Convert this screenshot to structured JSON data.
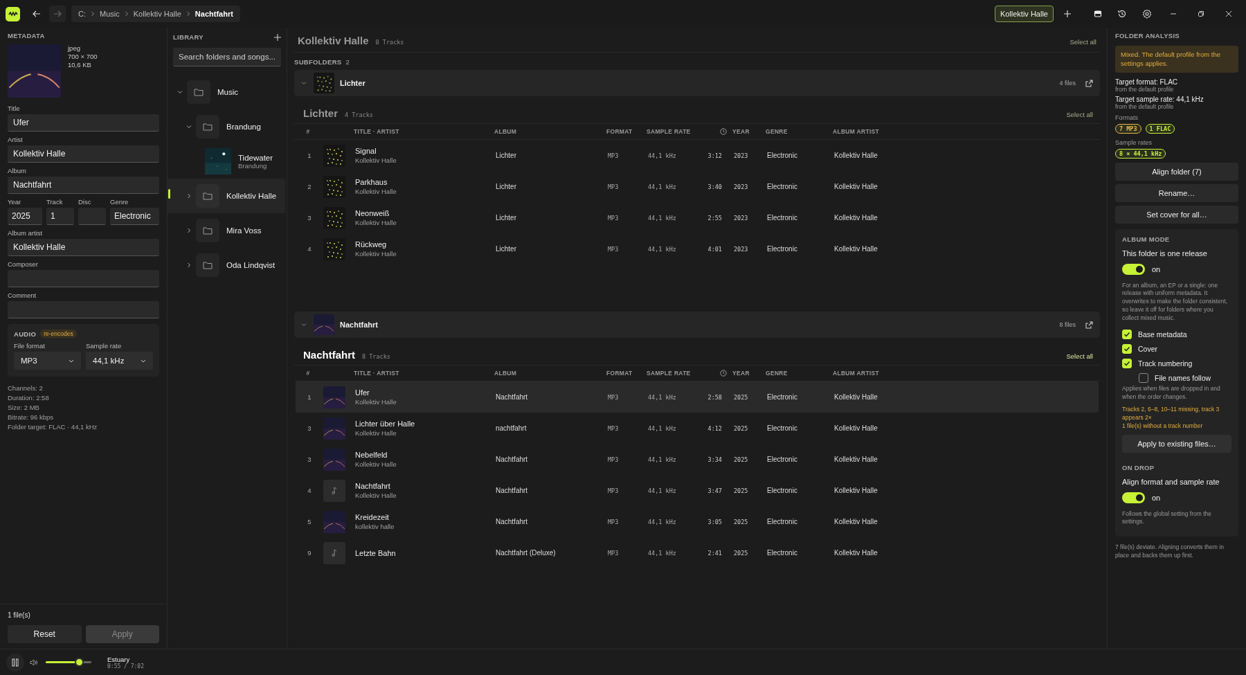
{
  "topbar": {
    "back_disabled": false,
    "forward_disabled": true,
    "breadcrumb": [
      "C:",
      "Music",
      "Kollektiv Halle",
      "Nachtfahrt"
    ],
    "context_chip": "Kollektiv Halle"
  },
  "metadata": {
    "heading": "METADATA",
    "cover": {
      "format": "jpeg",
      "dimensions": "700 × 700",
      "size": "10,6 KB"
    },
    "fields": [
      {
        "label": "Title",
        "value": "Ufer"
      },
      {
        "label": "Artist",
        "value": "Kollektiv Halle"
      },
      {
        "label": "Album",
        "value": "Nachtfahrt"
      }
    ],
    "row_fields": [
      {
        "label": "Year",
        "value": "2025"
      },
      {
        "label": "Track",
        "value": "1"
      },
      {
        "label": "Disc"
      },
      {
        "label": "Genre",
        "value": "Electronic"
      }
    ],
    "fields_after": [
      {
        "label": "Album artist",
        "value": "Kollektiv Halle"
      },
      {
        "label": "Composer"
      },
      {
        "label": "Comment"
      }
    ],
    "audio": {
      "heading": "AUDIO",
      "badge": "re-encodes",
      "selects": [
        {
          "label": "File format",
          "value": "MP3"
        },
        {
          "label": "Sample rate",
          "value": "44,1 kHz"
        }
      ]
    },
    "info": [
      "Channels: 2",
      "Duration: 2:58",
      "Size: 2 MB",
      "Bitrate: 96 kbps",
      "Folder target: FLAC · 44,1 kHz"
    ],
    "file_count": "1 file(s)",
    "buttons": [
      {
        "label": "Reset",
        "disabled": false
      },
      {
        "label": "Apply",
        "disabled": true
      }
    ]
  },
  "library": {
    "heading": "LIBRARY",
    "search": {
      "placeholder": "Search folders and songs..."
    },
    "tree": [
      {
        "kind": "folder",
        "label": "Music",
        "expanded": true,
        "selected": false,
        "children": [
          {
            "kind": "folder",
            "label": "Brandung",
            "expanded": true,
            "selected": false,
            "children": [
              {
                "kind": "album",
                "label": "Tidewater",
                "sublabel": "Brandung",
                "selected": false
              }
            ]
          },
          {
            "kind": "folder",
            "label": "Kollektiv Halle",
            "expanded": false,
            "selected": true
          },
          {
            "kind": "folder",
            "label": "Mira Voss",
            "expanded": false,
            "selected": false
          },
          {
            "kind": "folder",
            "label": "Oda Lindqvist",
            "expanded": false,
            "selected": false
          }
        ]
      }
    ]
  },
  "main": {
    "title": "Kollektiv Halle",
    "track_count": "0 Tracks",
    "select_all": "Select all",
    "subfolders_label": "SUBFOLDERS",
    "subfolders_count": "2",
    "subfolders": [
      {
        "name": "Lichter",
        "file_count": "4 files",
        "expanded": true,
        "active": false,
        "title": "Lichter",
        "track_count": "4 Tracks",
        "select_all": "Select all",
        "columns": [
          {
            "kind": "text",
            "label": "#"
          },
          {
            "kind": "text",
            "label": "TITLE · ARTIST"
          },
          {
            "kind": "text",
            "label": "ALBUM"
          },
          {
            "kind": "text",
            "label": "FORMAT"
          },
          {
            "kind": "text",
            "label": "SAMPLE RATE"
          },
          {
            "kind": "clock"
          },
          {
            "kind": "text",
            "label": "YEAR"
          },
          {
            "kind": "text",
            "label": "GENRE"
          },
          {
            "kind": "text",
            "label": "ALBUM ARTIST"
          }
        ],
        "rows": [
          {
            "number": "1",
            "has_cover": true,
            "title": "Signal",
            "artist": "Kollektiv Halle",
            "album": "Lichter",
            "format": "MP3",
            "sample_rate": "44,1 kHz",
            "duration": "3:12",
            "year": "2023",
            "genre": "Electronic",
            "album_artist": "Kollektiv Halle",
            "selected": false
          },
          {
            "number": "2",
            "has_cover": true,
            "title": "Parkhaus",
            "artist": "Kollektiv Halle",
            "album": "Lichter",
            "format": "MP3",
            "sample_rate": "44,1 kHz",
            "duration": "3:40",
            "year": "2023",
            "genre": "Electronic",
            "album_artist": "Kollektiv Halle",
            "selected": false
          },
          {
            "number": "3",
            "has_cover": true,
            "title": "Neonweiß",
            "artist": "Kollektiv Halle",
            "album": "Lichter",
            "format": "MP3",
            "sample_rate": "44,1 kHz",
            "duration": "2:55",
            "year": "2023",
            "genre": "Electronic",
            "album_artist": "Kollektiv Halle",
            "selected": false
          },
          {
            "number": "4",
            "has_cover": true,
            "title": "Rückweg",
            "artist": "Kollektiv Halle",
            "album": "Lichter",
            "format": "MP3",
            "sample_rate": "44,1 kHz",
            "duration": "4:01",
            "year": "2023",
            "genre": "Electronic",
            "album_artist": "Kollektiv Halle",
            "selected": false
          }
        ]
      },
      {
        "name": "Nachtfahrt",
        "file_count": "8 files",
        "expanded": true,
        "active": true,
        "title": "Nachtfahrt",
        "track_count": "8 Tracks",
        "select_all": "Select all",
        "columns": [
          {
            "kind": "text",
            "label": "#"
          },
          {
            "kind": "text",
            "label": "TITLE · ARTIST"
          },
          {
            "kind": "text",
            "label": "ALBUM"
          },
          {
            "kind": "text",
            "label": "FORMAT"
          },
          {
            "kind": "text",
            "label": "SAMPLE RATE"
          },
          {
            "kind": "clock"
          },
          {
            "kind": "text",
            "label": "YEAR"
          },
          {
            "kind": "text",
            "label": "GENRE"
          },
          {
            "kind": "text",
            "label": "ALBUM ARTIST"
          }
        ],
        "rows": [
          {
            "number": "1",
            "has_cover": true,
            "title": "Ufer",
            "artist": "Kollektiv Halle",
            "album": "Nachtfahrt",
            "format": "MP3",
            "sample_rate": "44,1 kHz",
            "duration": "2:58",
            "year": "2025",
            "genre": "Electronic",
            "album_artist": "Kollektiv Halle",
            "selected": true
          },
          {
            "number": "3",
            "has_cover": true,
            "title": "Lichter über Halle",
            "artist": "Kollektiv Halle",
            "album": "nachtfahrt",
            "format": "MP3",
            "sample_rate": "44,1 kHz",
            "duration": "4:12",
            "year": "2025",
            "genre": "Electronic",
            "album_artist": "Kollektiv Halle",
            "selected": false
          },
          {
            "number": "3",
            "has_cover": true,
            "title": "Nebelfeld",
            "artist": "Kollektiv Halle",
            "album": "Nachtfahrt",
            "format": "MP3",
            "sample_rate": "44,1 kHz",
            "duration": "3:34",
            "year": "2025",
            "genre": "Electronic",
            "album_artist": "Kollektiv Halle",
            "selected": false
          },
          {
            "number": "4",
            "has_cover": false,
            "title": "Nachtfahrt",
            "artist": "Kollektiv Halle",
            "album": "Nachtfahrt",
            "format": "MP3",
            "sample_rate": "44,1 kHz",
            "duration": "3:47",
            "year": "2025",
            "genre": "Electronic",
            "album_artist": "Kollektiv Halle",
            "selected": false
          },
          {
            "number": "5",
            "has_cover": true,
            "title": "Kreidezeit",
            "artist": "kollektiv halle",
            "album": "Nachtfahrt",
            "format": "MP3",
            "sample_rate": "44,1 kHz",
            "duration": "3:05",
            "year": "2025",
            "genre": "Electronic",
            "album_artist": "Kollektiv Halle",
            "selected": false
          },
          {
            "number": "9",
            "has_cover": false,
            "title": "Letzte Bahn",
            "album": "Nachtfahrt (Deluxe)",
            "format": "MP3",
            "sample_rate": "44,1 kHz",
            "duration": "2:41",
            "year": "2025",
            "genre": "Electronic",
            "album_artist": "Kollektiv Halle",
            "selected": false
          }
        ]
      }
    ]
  },
  "analysis": {
    "heading": "FOLDER ANALYSIS",
    "notice": "Mixed. The default profile from the settings applies.",
    "targets": [
      {
        "label": "Target format: FLAC",
        "source": "from the default profile"
      },
      {
        "label": "Target sample rate: 44,1 kHz",
        "source": "from the default profile"
      }
    ],
    "formats_label": "Formats",
    "formats": [
      {
        "label": "7 MP3",
        "color": "#e8b84a"
      },
      {
        "label": "1 FLAC",
        "color": "#c6f135"
      }
    ],
    "sample_rates_label": "Sample rates",
    "sample_rates": [
      {
        "label": "8 × 44,1 kHz",
        "color": "#c6f135"
      }
    ],
    "actions": [
      "Align folder (7)",
      "Rename…",
      "Set cover for all…"
    ],
    "album_mode": {
      "heading": "ALBUM MODE",
      "title": "This folder is one release",
      "toggle": {
        "on": true,
        "label": "on"
      },
      "description": "For an album, an EP or a single: one release with uniform metadata. It overwrites to make the folder consistent, so leave it off for folders where you collect mixed music.",
      "options": [
        {
          "label": "Base metadata",
          "checked": true
        },
        {
          "label": "Cover",
          "checked": true
        },
        {
          "label": "Track numbering",
          "checked": true,
          "children": [
            {
              "label": "File names follow",
              "checked": false
            }
          ]
        }
      ],
      "hint": "Applies when files are dropped in and when the order changes.",
      "warnings": [
        "Tracks 2, 6–8, 10–11 missing, track 3 appears 2×",
        "1 file(s) without a track number"
      ],
      "apply_button": "Apply to existing files…"
    },
    "on_drop": {
      "heading": "ON DROP",
      "title": "Align format and sample rate",
      "toggle": {
        "on": true,
        "label": "on"
      },
      "description": "Follows the global setting from the settings."
    },
    "footer": "7 file(s) deviate. Aligning converts them in place and backs them up first."
  },
  "player": {
    "playing": true,
    "volume": {
      "level": 0.66
    },
    "title": "Estuary",
    "time": "0:55 / 7:02"
  }
}
